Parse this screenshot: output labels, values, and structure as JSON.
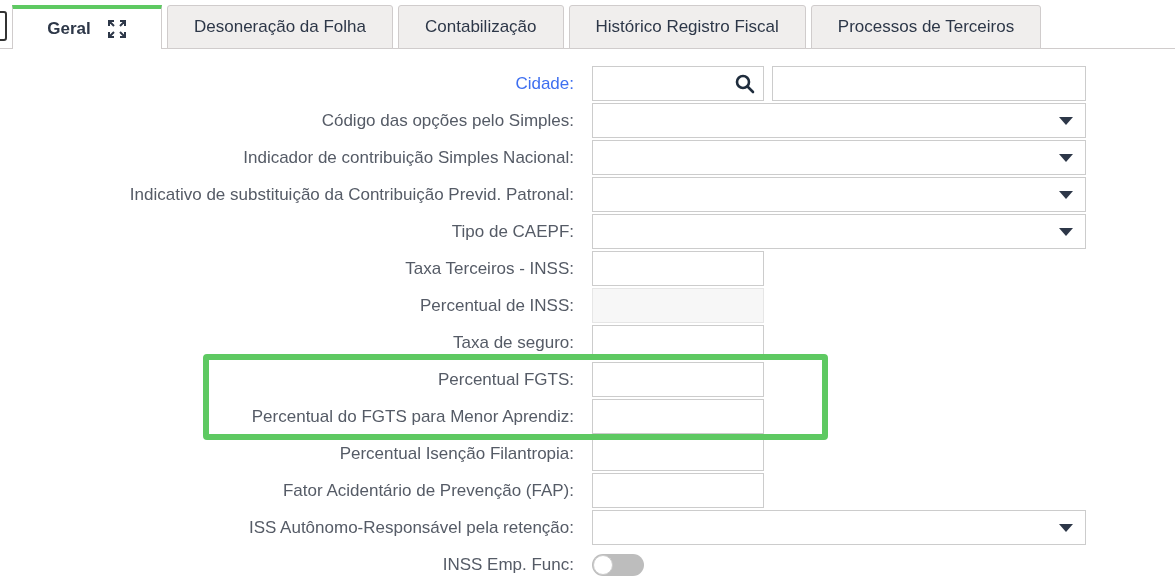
{
  "tabs": [
    {
      "label": "Geral",
      "selected": true,
      "expand_icon": true
    },
    {
      "label": "Desoneração da Folha",
      "selected": false,
      "expand_icon": false
    },
    {
      "label": "Contabilização",
      "selected": false,
      "expand_icon": false
    },
    {
      "label": "Histórico Registro Fiscal",
      "selected": false,
      "expand_icon": false
    },
    {
      "label": "Processos de Terceiros",
      "selected": false,
      "expand_icon": false
    }
  ],
  "fields": [
    {
      "label": "Cidade:",
      "kind": "lookup",
      "highlighted": false
    },
    {
      "label": "Código das opções pelo Simples:",
      "kind": "select",
      "highlighted": false
    },
    {
      "label": "Indicador de contribuição Simples Nacional:",
      "kind": "select",
      "highlighted": false
    },
    {
      "label": "Indicativo de substituição da Contribuição Previd. Patronal:",
      "kind": "select",
      "highlighted": false
    },
    {
      "label": "Tipo de CAEPF:",
      "kind": "select",
      "highlighted": false
    },
    {
      "label": "Taxa Terceiros - INSS:",
      "kind": "text",
      "highlighted": false
    },
    {
      "label": "Percentual de INSS:",
      "kind": "disabled",
      "highlighted": false
    },
    {
      "label": "Taxa de seguro:",
      "kind": "text",
      "highlighted": false
    },
    {
      "label": "Percentual FGTS:",
      "kind": "text",
      "highlighted": true
    },
    {
      "label": "Percentual do FGTS para Menor Aprendiz:",
      "kind": "text",
      "highlighted": true
    },
    {
      "label": "Percentual Isenção Filantropia:",
      "kind": "text",
      "highlighted": false
    },
    {
      "label": "Fator Acidentário de Prevenção (FAP):",
      "kind": "text",
      "highlighted": false
    },
    {
      "label": "ISS Autônomo-Responsável pela retenção:",
      "kind": "select",
      "highlighted": false
    },
    {
      "label": "INSS Emp. Func:",
      "kind": "toggle",
      "on": false,
      "highlighted": false
    }
  ]
}
